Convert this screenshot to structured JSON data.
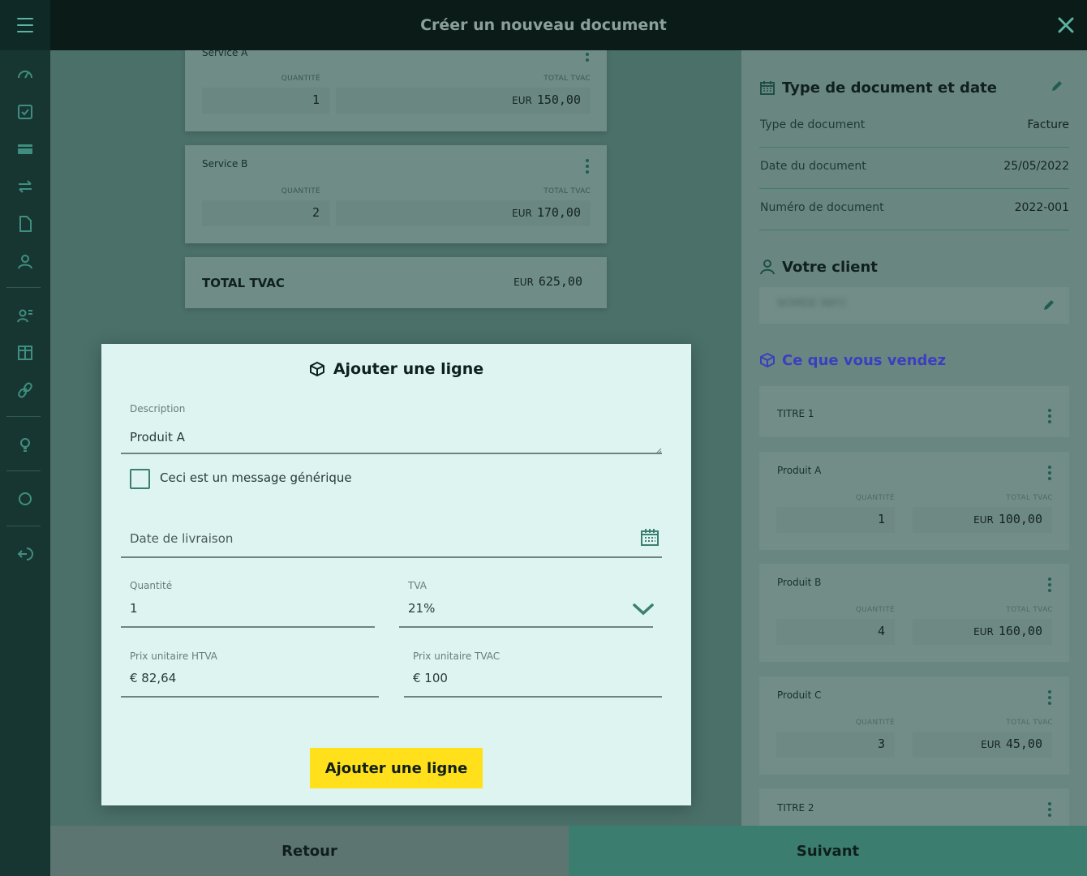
{
  "topbar": {
    "title": "Créer un nouveau document"
  },
  "main": {
    "cards": [
      {
        "name": "Service A",
        "qty_label": "QUANTITÉ",
        "qty": "1",
        "total_label": "TOTAL TVAC",
        "currency": "EUR",
        "total": "150,00"
      },
      {
        "name": "Service B",
        "qty_label": "QUANTITÉ",
        "qty": "2",
        "total_label": "TOTAL TVAC",
        "currency": "EUR",
        "total": "170,00"
      }
    ],
    "grand_total": {
      "label": "TOTAL TVAC",
      "currency": "EUR",
      "amount": "625,00"
    }
  },
  "right": {
    "doc_section": {
      "title": "Type de document et date",
      "rows": [
        {
          "label": "Type de document",
          "value": "Facture"
        },
        {
          "label": "Date du document",
          "value": "25/05/2022"
        },
        {
          "label": "Numéro de document",
          "value": "2022-001"
        }
      ]
    },
    "client_section": {
      "title": "Votre client",
      "client_name": "NOMDE INFO"
    },
    "sell_section": {
      "title": "Ce que vous vendez",
      "titre1": "TITRE 1",
      "titre2": "TITRE 2",
      "items": [
        {
          "name": "Produit A",
          "qty_label": "QUANTITÉ",
          "qty": "1",
          "total_label": "TOTAL TVAC",
          "currency": "EUR",
          "total": "100,00"
        },
        {
          "name": "Produit B",
          "qty_label": "QUANTITÉ",
          "qty": "4",
          "total_label": "TOTAL TVAC",
          "currency": "EUR",
          "total": "160,00"
        },
        {
          "name": "Produit C",
          "qty_label": "QUANTITÉ",
          "qty": "3",
          "total_label": "TOTAL TVAC",
          "currency": "EUR",
          "total": "45,00"
        }
      ]
    },
    "accent": "#3b3fbf"
  },
  "modal": {
    "title": "Ajouter une ligne",
    "description_label": "Description",
    "description_value": "Produit A",
    "checkbox_label": "Ceci est un message générique",
    "delivery_placeholder": "Date de livraison",
    "quantity_label": "Quantité",
    "quantity_value": "1",
    "tva_label": "TVA",
    "tva_value": "21%",
    "price_htva_label": "Prix unitaire HTVA",
    "price_htva_value": "€ 82,64",
    "price_tvac_label": "Prix unitaire TVAC",
    "price_tvac_value": "€ 100",
    "submit_label": "Ajouter une ligne"
  },
  "footer": {
    "back_label": "Retour",
    "next_label": "Suivant"
  },
  "colors": {
    "button_yellow": "#ffe01b",
    "teal": "#3b7e70",
    "dark": "#0a1b18"
  }
}
